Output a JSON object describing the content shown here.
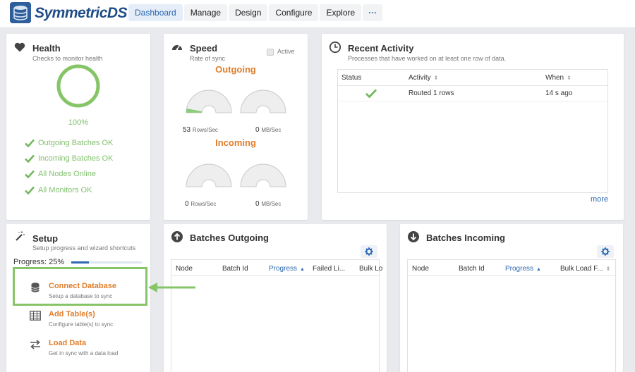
{
  "app": {
    "title": "SymmetricDS"
  },
  "nav": {
    "items": [
      {
        "label": "Dashboard",
        "active": true
      },
      {
        "label": "Manage"
      },
      {
        "label": "Design"
      },
      {
        "label": "Configure"
      },
      {
        "label": "Explore"
      }
    ],
    "more_label": "···"
  },
  "health": {
    "title": "Health",
    "subtitle": "Checks to monitor health",
    "percent": "100%",
    "percent_value": 1.0,
    "checks": [
      "Outgoing Batches OK",
      "Incoming Batches OK",
      "All Nodes Online",
      "All Monitors OK"
    ],
    "accent_color": "#86c567"
  },
  "speed": {
    "title": "Speed",
    "subtitle": "Rate of sync",
    "active_label": "Active",
    "outgoing_title": "Outgoing",
    "incoming_title": "Incoming",
    "outgoing": {
      "rows_value": "53",
      "rows_unit": "Rows/Sec",
      "mb_value": "0",
      "mb_unit": "MB/Sec",
      "rows_fraction": 0.06
    },
    "incoming": {
      "rows_value": "0",
      "rows_unit": "Rows/Sec",
      "mb_value": "0",
      "mb_unit": "MB/Sec"
    },
    "heading_color": "#e07e2c"
  },
  "recent_activity": {
    "title": "Recent Activity",
    "subtitle": "Processes that have worked on at least one row of data.",
    "columns": [
      "Status",
      "Activity",
      "When"
    ],
    "rows": [
      {
        "status": "success",
        "activity": "Routed 1 rows",
        "when": "14 s ago"
      }
    ],
    "more_label": "more"
  },
  "setup": {
    "title": "Setup",
    "subtitle": "Setup progress and wizard shortcuts",
    "progress_label": "Progress: 25%",
    "progress_value": 0.25,
    "items": [
      {
        "title": "Connect Database",
        "desc": "Setup a database to sync",
        "icon": "database-icon"
      },
      {
        "title": "Add Table(s)",
        "desc": "Configure table(s) to sync",
        "icon": "table-icon"
      },
      {
        "title": "Load Data",
        "desc": "Get in sync with a data load",
        "icon": "exchange-icon"
      }
    ]
  },
  "batches_outgoing": {
    "title": "Batches Outgoing",
    "columns": [
      "Node",
      "Batch Id",
      "Progress",
      "Failed Li...",
      "Bulk Lo"
    ]
  },
  "batches_incoming": {
    "title": "Batches Incoming",
    "columns": [
      "Node",
      "Batch Id",
      "Progress",
      "Bulk Load F..."
    ]
  },
  "colors": {
    "brand": "#1f4c86",
    "link": "#2c68b0",
    "orange": "#e07e2c",
    "green": "#86c567"
  }
}
